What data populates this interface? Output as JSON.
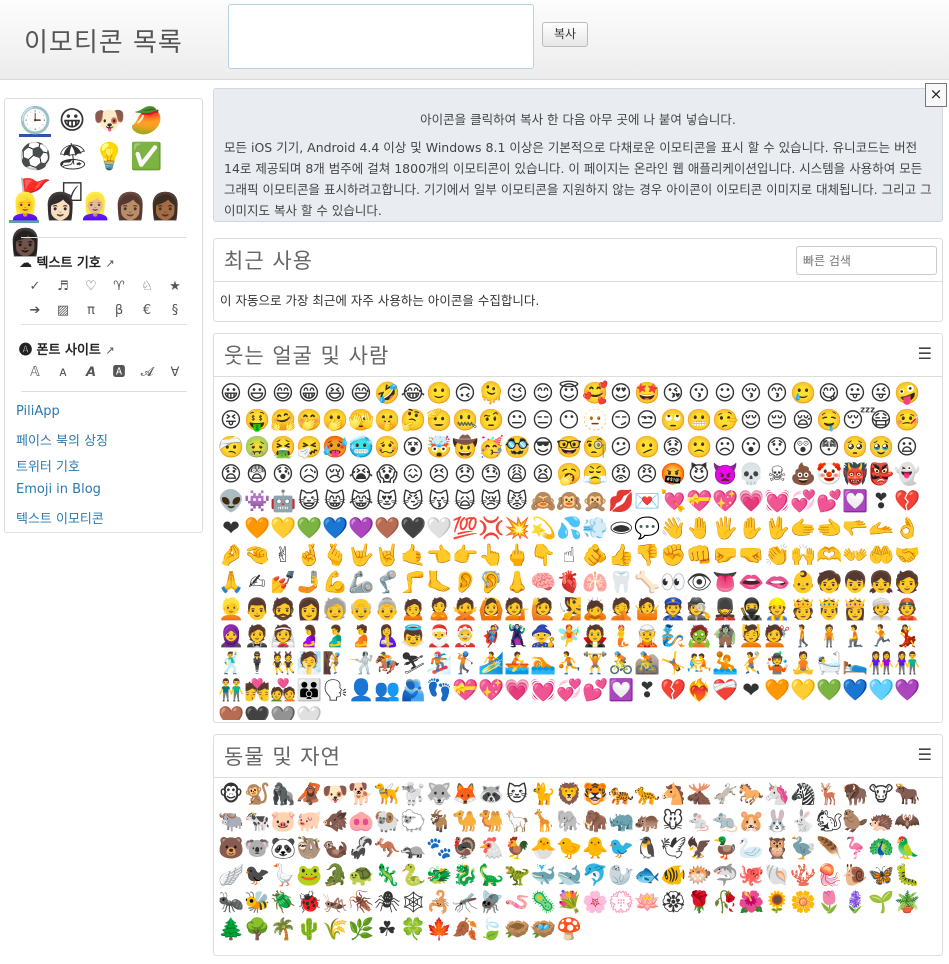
{
  "header": {
    "title": "이모티콘 목록",
    "copy_button": "복사"
  },
  "sidebar": {
    "emoji_row1": [
      "🕒",
      "😀",
      "🐶",
      "🥭",
      "⚽"
    ],
    "emoji_row2": [
      "🏖",
      "💡",
      "✅",
      "🚩",
      "☑"
    ],
    "skin_tones": [
      "👱‍♀️",
      "👩🏻",
      "👱🏼‍♀️",
      "👩🏽",
      "👩🏾",
      "👩🏿"
    ],
    "text_symbols_title": "텍스트 기호",
    "text_symbols": [
      "✓",
      "♬",
      "♡",
      "♈",
      "♘",
      "★",
      "➔",
      "▨",
      "π",
      "β",
      "€",
      "§"
    ],
    "font_sites_title": "폰트 사이트",
    "font_samples": [
      "𝔸",
      "ᴀ",
      "𝘼",
      "🅰",
      "𝓐",
      "∀"
    ],
    "links": [
      "PiliApp",
      "페이스 북의 상징",
      "트위터 기호",
      "Emoji in Blog",
      "텍스트 이모티콘"
    ]
  },
  "info": {
    "line1": "아이콘을 클릭하여 복사 한 다음 아무 곳에 나 붙여 넣습니다.",
    "paragraph": "모든 iOS 기기, Android 4.4 이상 및 Windows 8.1 이상은 기본적으로 다채로운 이모티콘을 표시 할 수 있습니다. 유니코드는 버전 14로 제공되며 8개 범주에 걸쳐 1800개의 이모티콘이 있습니다. 이 페이지는 온라인 웹 애플리케이션입니다. 시스템을 사용하여 모든 그래픽 이모티콘을 표시하려고합니다. 기기에서 일부 이모티콘을 지원하지 않는 경우 아이콘이 이모티콘 이미지로 대체됩니다. 그리고 그 이미지도 복사 할 수 있습니다.",
    "close": "×"
  },
  "recent": {
    "title": "최근 사용",
    "search_placeholder": "빠른 검색",
    "desc": "이 자동으로 가장 최근에 자주 사용하는 아이콘을 수집합니다."
  },
  "smileys": {
    "title": "웃는 얼굴 및 사람",
    "emojis": "😀😃😄😁😆😅🤣😂🙂🙃🫠😉😊😇🥰😍🤩😘😗☺😚😙🥲😋😛😜🤪😝🤑🤗🤭🫢🫣🤫🤔🫡🤐🤨😐😑😶🫥😏😒🙄😬🤥😌😔😪🤤😴😷🤒🤕🤢🤮🤧🥵🥶🥴😵🤯🤠🥳🥸😎🤓🧐😕🫤😟🙁☹😮😯😲😳🥺🥹😦😧😨😰😥😢😭😱😖😣😞😓😩😫🥱😤😡😠🤬😈👿💀☠💩🤡👹👺👻👽👾🤖😺😸😹😻😼😽🙀😿😾🙈🙉🙊💋💌💘💝💖💗💓💞💕💟❣💔❤🧡💛💚💙💜🤎🖤🤍💯💢💥💫💦💨🕳💬👋🤚🖐✋🖖🫱🫲🫳🫴👌🤌🤏✌🤞🫰🤟🤘🤙👈👉👆🖕👇☝🫵👍👎✊👊🤛🤜👏🙌🫶👐🤲🤝🙏✍💅🤳💪🦾🦿🦵🦶👂🦻👃🧠🫀🫁🦷🦴👀👁👅👄🫦👶🧒👦👧🧑👱👨🧔👩🧓👴👵🙍🙎🙅🙆💁🙋🧏🙇🤦🤷👮🕵💂🥷👷🫅🤴👸👳👲🧕🤵👰🤰🫃🫄🤱👼🎅🤶🦸🦹🧙🧚🧛🧜🧝🧞🧟🧌💆💇🚶🧍🧎🏃💃🕺🕴👯🧖🧗🤺🏇⛷🏂🏌🏄🚣🏊⛹🏋🚴🚵🤸🤼🤽🤾🤹🧘🛀🛌👭👫👬💏💑👪🗣👤👥🫂👣💝💖💗💓💞💕💟❣💔❤‍🔥❤‍🩹❤🧡💛💚💙🩵💜🤎🖤🩶🤍"
  },
  "animals": {
    "title": "동물 및 자연",
    "emojis": "🐵🐒🦍🦧🐶🐕🦮🐩🐺🦊🦝🐱🐈🦁🐯🐅🐆🐴🫎🫏🐎🦄🦓🦌🦬🐮🐂🐃🐄🐷🐖🐗🐽🐏🐑🐐🐪🐫🦙🦒🐘🦣🦏🦛🐭🐁🐀🐹🐰🐇🐿🦫🦔🦇🐻🐨🐼🦥🦦🦨🦘🦡🐾🦃🐔🐓🐣🐤🐥🐦🐧🕊🦅🦆🦢🦉🦤🪶🦩🦚🦜🪽🐦‍⬛🪿🐸🐊🐢🦎🐍🐲🐉🦕🦖🐳🐋🐬🦭🐟🐠🐡🦈🐙🐚🪸🪼🐌🦋🐛🐜🐝🪲🐞🦗🪳🕷🕸🦂🦟🪰🪱🦠💐🌸💮🪷🏵🌹🥀🌺🌻🌼🌷🪻🌱🪴🌲🌳🌴🌵🌾🌿☘🍀🍁🍂🍃🪹🪺🍄"
  }
}
